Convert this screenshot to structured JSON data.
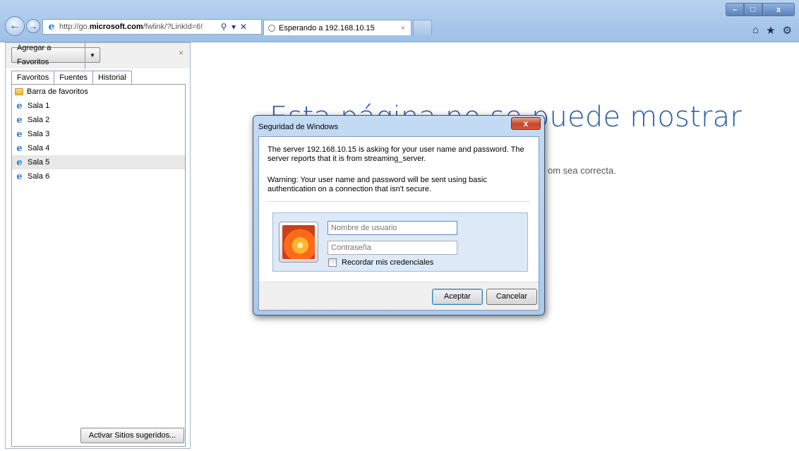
{
  "address_bar": {
    "url_prefix": "http://go.",
    "url_domain": "microsoft.com",
    "url_suffix": "/fwlink/?LinkId=6!",
    "search_glyph": "⚲",
    "dropdown_glyph": "▾",
    "stop_glyph": "✕"
  },
  "tab": {
    "title": "Esperando a 192.168.10.15",
    "close_glyph": "×"
  },
  "window_controls": {
    "minimize": "–",
    "maximize": "□",
    "close": "x"
  },
  "toolbar": {
    "home_icon": "home-icon",
    "favorites_icon": "star-icon",
    "tools_icon": "gear-icon"
  },
  "favorites": {
    "add_button": "Agregar a Favoritos",
    "add_button_arrow": "▼",
    "close_glyph": "×",
    "tabs": [
      "Favoritos",
      "Fuentes",
      "Historial"
    ],
    "items": [
      {
        "label": "Barra de favoritos",
        "icon": "folder-icon"
      },
      {
        "label": "Sala 1",
        "icon": "ie-page-icon"
      },
      {
        "label": "Sala 2",
        "icon": "ie-page-icon"
      },
      {
        "label": "Sala 3",
        "icon": "ie-page-icon"
      },
      {
        "label": "Sala 4",
        "icon": "ie-page-icon"
      },
      {
        "label": "Sala 5",
        "icon": "ie-page-icon",
        "selected": true
      },
      {
        "label": "Sala 6",
        "icon": "ie-page-icon"
      }
    ],
    "suggested_button": "Activar Sitios sugeridos..."
  },
  "page": {
    "error_title": "Esta página no se puede mostrar",
    "error_detail": "om sea correcta."
  },
  "dialog": {
    "title": "Seguridad de Windows",
    "close_glyph": "x",
    "message": "The server 192.168.10.15 is asking for your user name and password. The server reports that it is from streaming_server.",
    "warning": "Warning: Your user name and password will be sent using basic authentication on a connection that isn't secure.",
    "username_placeholder": "Nombre de usuario",
    "password_placeholder": "Contraseña",
    "remember_label": "Recordar mis credenciales",
    "ok_button": "Aceptar",
    "cancel_button": "Cancelar"
  },
  "colors": {
    "chrome": "#a9c8ea",
    "error_title": "#2a5ba8",
    "dialog_close": "#c6472b"
  }
}
